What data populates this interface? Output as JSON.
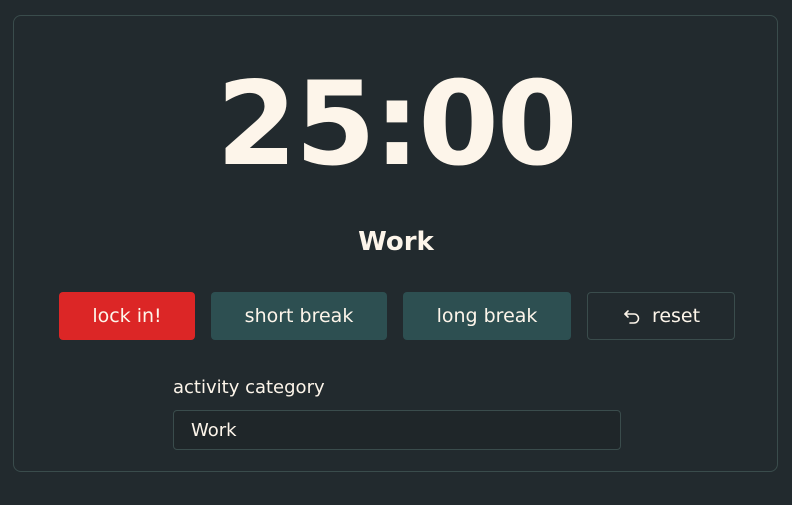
{
  "timer": {
    "display": "25:00"
  },
  "mode": {
    "label": "Work"
  },
  "buttons": {
    "lock_in": "lock in!",
    "short_break": "short break",
    "long_break": "long break",
    "reset": "reset",
    "reset_icon": "undo-arrow-icon"
  },
  "category": {
    "label": "activity category",
    "value": "Work"
  },
  "colors": {
    "background": "#222a2e",
    "text": "#fdf5ea",
    "accent_red": "#dc2626",
    "button_teal": "#2d4f51",
    "border": "#3a4c4c"
  }
}
